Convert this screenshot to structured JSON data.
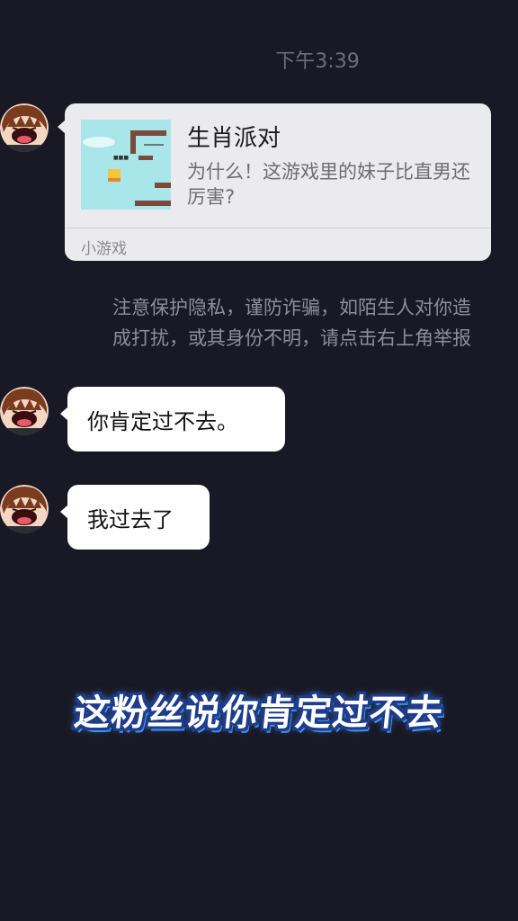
{
  "chat": {
    "timestamp": "下午3:39",
    "minigame_card": {
      "title": "生肖派对",
      "description": "为什么！这游戏里的妹子比直男还厉害?",
      "footer": "小游戏",
      "thumbnail_icon": "platform-game-thumbnail"
    },
    "safety_notice": {
      "line1": "注意保护隐私，谨防诈骗，如陌生人对你造",
      "line2": "成打扰，或其身份不明，请点击右上角举报"
    },
    "messages": [
      {
        "text": "你肯定过不去。",
        "avatar_icon": "anime-avatar"
      },
      {
        "text": "我过去了",
        "avatar_icon": "anime-avatar"
      }
    ]
  },
  "overlay": {
    "caption": "这粉丝说你肯定过不去"
  },
  "colors": {
    "background": "#191825",
    "bubble": "#ffffff",
    "card": "#ebebef",
    "caption_outline": "#1d3c8c"
  }
}
